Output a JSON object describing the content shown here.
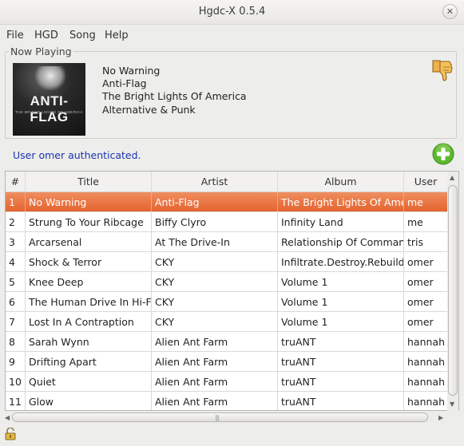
{
  "window": {
    "title": "Hgdc-X 0.5.4",
    "close_glyph": "✕"
  },
  "menu": [
    {
      "label": "File"
    },
    {
      "label": "HGD"
    },
    {
      "label": "Song"
    },
    {
      "label": "Help"
    }
  ],
  "now_playing": {
    "label": "Now Playing",
    "title": "No Warning",
    "artist": "Anti-Flag",
    "album": "The Bright Lights Of America",
    "genre": "Alternative & Punk",
    "cover_logo": "ANTI-FLAG",
    "cover_subtitle": "THE BRIGHT LIGHTS OF AMERICA"
  },
  "status": {
    "text": "User omer authenticated."
  },
  "playlist": {
    "columns": [
      "#",
      "Title",
      "Artist",
      "Album",
      "User"
    ],
    "rows": [
      {
        "num": "1",
        "title": "No Warning",
        "artist": "Anti-Flag",
        "album": "The Bright Lights Of America",
        "user": "me"
      },
      {
        "num": "2",
        "title": "Strung To Your Ribcage",
        "artist": "Biffy Clyro",
        "album": "Infinity Land",
        "user": "me"
      },
      {
        "num": "3",
        "title": "Arcarsenal",
        "artist": "At The Drive-In",
        "album": "Relationship Of Command",
        "user": "tris"
      },
      {
        "num": "4",
        "title": "Shock & Terror",
        "artist": "CKY",
        "album": "Infiltrate.Destroy.Rebuild",
        "user": "omer"
      },
      {
        "num": "5",
        "title": "Knee Deep",
        "artist": "CKY",
        "album": "Volume 1",
        "user": "omer"
      },
      {
        "num": "6",
        "title": "The Human Drive In Hi-Fi",
        "artist": "CKY",
        "album": "Volume 1",
        "user": "omer"
      },
      {
        "num": "7",
        "title": "Lost In A Contraption",
        "artist": "CKY",
        "album": "Volume 1",
        "user": "omer"
      },
      {
        "num": "8",
        "title": "Sarah Wynn",
        "artist": "Alien Ant Farm",
        "album": "truANT",
        "user": "hannah"
      },
      {
        "num": "9",
        "title": "Drifting Apart",
        "artist": "Alien Ant Farm",
        "album": "truANT",
        "user": "hannah"
      },
      {
        "num": "10",
        "title": "Quiet",
        "artist": "Alien Ant Farm",
        "album": "truANT",
        "user": "hannah"
      },
      {
        "num": "11",
        "title": "Glow",
        "artist": "Alien Ant Farm",
        "album": "truANT",
        "user": "hannah"
      }
    ],
    "selected_row": 0
  },
  "colors": {
    "selection": "#e8713f",
    "status_text": "#1a34b0",
    "add_button": "#5cb82e",
    "thumb_icon": "#e8a63a"
  },
  "icons": {
    "vote_off": "thumbs-down-icon",
    "add": "plus-icon",
    "security": "unlocked-padlock-icon"
  }
}
